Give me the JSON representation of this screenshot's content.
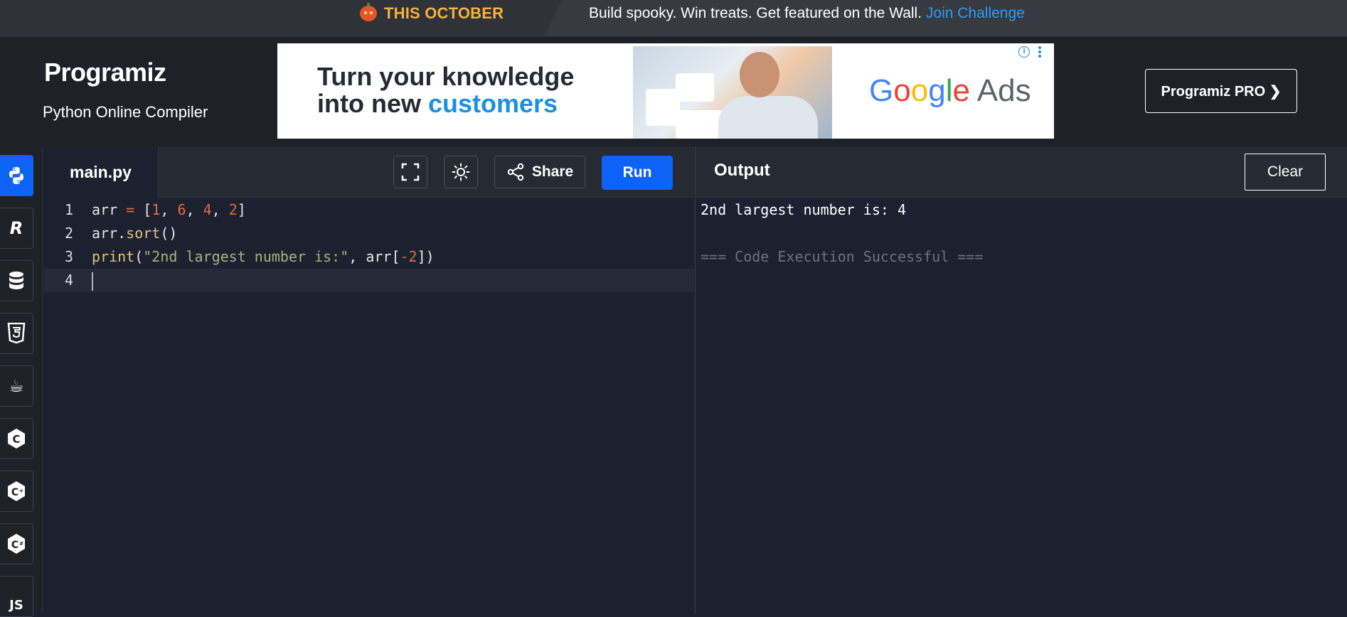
{
  "promo": {
    "highlight": "THIS OCTOBER",
    "message": "Build spooky. Win treats. Get featured on the Wall.",
    "link": "Join Challenge"
  },
  "header": {
    "logo": "Programiz",
    "subtitle": "Python Online Compiler",
    "pro_button": "Programiz PRO ❯"
  },
  "ad": {
    "headline_line1": "Turn your knowledge",
    "headline_line2_start": "into new ",
    "headline_line2_accent": "customers",
    "brand_google": [
      "G",
      "o",
      "o",
      "g",
      "l",
      "e"
    ],
    "brand_ads": " Ads",
    "info_glyph": "i"
  },
  "sidebar": {
    "languages": [
      {
        "name": "python",
        "glyph": "🐍",
        "active": true
      },
      {
        "name": "r",
        "glyph": "R"
      },
      {
        "name": "sql",
        "glyph": "⛁"
      },
      {
        "name": "html",
        "glyph": "5"
      },
      {
        "name": "java",
        "glyph": "☕"
      },
      {
        "name": "c",
        "glyph": "C"
      },
      {
        "name": "cpp",
        "glyph": "C"
      },
      {
        "name": "csharp",
        "glyph": "C"
      },
      {
        "name": "js",
        "glyph": "JS"
      }
    ]
  },
  "editor": {
    "tab_label": "main.py",
    "share_label": "Share",
    "run_label": "Run",
    "line_numbers": [
      "1",
      "2",
      "3",
      "4"
    ],
    "lines": {
      "l1": {
        "a": "arr ",
        "b": "=",
        "c": " [",
        "n1": "1",
        "s1": ", ",
        "n2": "6",
        "s2": ", ",
        "n3": "4",
        "s3": ", ",
        "n4": "2",
        "end": "]"
      },
      "l2": {
        "a": "arr.",
        "fn": "sort",
        "end": "()"
      },
      "l3": {
        "fn": "print",
        "p": "(",
        "str": "\"2nd largest number is:\"",
        "mid": ", arr[",
        "num": "-2",
        "end": "])"
      }
    }
  },
  "output": {
    "title": "Output",
    "clear_label": "Clear",
    "line1": "2nd largest number is: 4",
    "line2": "=== Code Execution Successful ==="
  },
  "colors": {
    "accent": "#0e62f5",
    "promo_highlight": "#f6b23a",
    "link": "#2c9cf5",
    "editor_bg": "#1c2130"
  }
}
